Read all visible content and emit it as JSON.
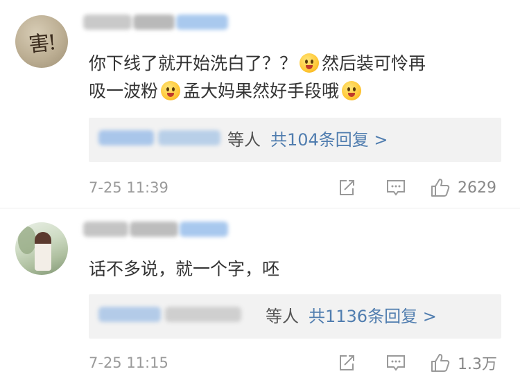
{
  "comments": [
    {
      "content": "你下线了就开始洗白了？？ 😱然后装可怜再吸一波粉😱孟大妈果然好手段哦🤭",
      "content_line1": "你下线了就开始洗白了？？",
      "content_line1b": "然后装可怜再",
      "content_line2a": "吸一波粉",
      "content_line2b": "孟大妈果然好手段哦",
      "reply_others": "等人",
      "reply_count": "共104条回复 >",
      "time": "7-25 11:39",
      "likes": "2629",
      "emojis": [
        "scream-emoji",
        "scream-emoji",
        "shush-emoji"
      ]
    },
    {
      "content": "话不多说，就一个字，呸",
      "reply_others": "等人",
      "reply_count": "共1136条回复 >",
      "time": "7-25 11:15",
      "likes": "1.3万"
    }
  ],
  "icons": {
    "share": "share-icon",
    "comment": "comment-icon",
    "like": "thumbs-up-icon"
  },
  "colors": {
    "link": "#507daf",
    "reply_bg": "#f2f2f2",
    "meta": "#9a9a9a"
  }
}
